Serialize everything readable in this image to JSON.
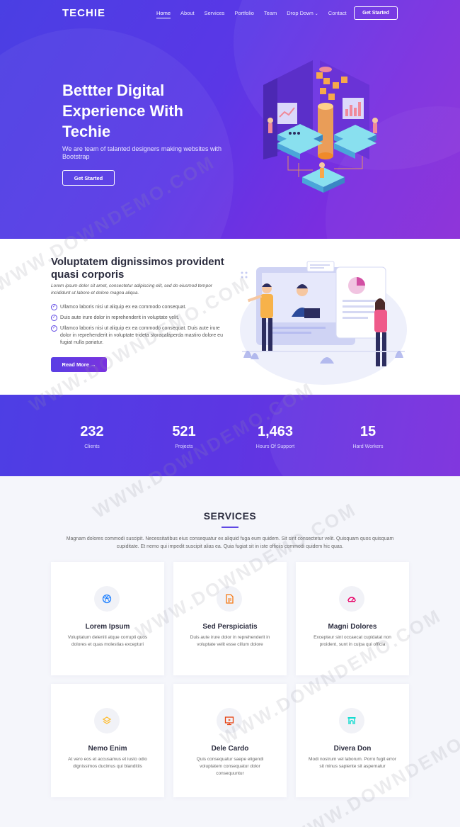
{
  "nav": {
    "logo": "TECHIE",
    "items": [
      "Home",
      "About",
      "Services",
      "Portfolio",
      "Team",
      "Drop Down",
      "Contact"
    ],
    "cta": "Get Started"
  },
  "hero": {
    "title": "Bettter Digital Experience With Techie",
    "subtitle": "We are team of talanted designers making websites with Bootstrap",
    "cta": "Get Started"
  },
  "about": {
    "title": "Voluptatem dignissimos provident quasi corporis",
    "lead": "Lorem ipsum dolor sit amet, consectetur adipiscing elit, sed do eiusmod tempor incididunt ut labore et dolore magna aliqua.",
    "bullets": [
      "Ullamco laboris nisi ut aliquip ex ea commodo consequat.",
      "Duis aute irure dolor in reprehenderit in voluptate velit.",
      "Ullamco laboris nisi ut aliquip ex ea commodo consequat. Duis aute irure dolor in reprehenderit in voluptate trideta storacalaperda mastiro dolore eu fugiat nulla pariatur."
    ],
    "cta": "Read More",
    "cta_arrow": "→"
  },
  "counts": [
    {
      "value": "232",
      "label": "Clients"
    },
    {
      "value": "521",
      "label": "Projects"
    },
    {
      "value": "1,463",
      "label": "Hours Of Support"
    },
    {
      "value": "15",
      "label": "Hard Workers"
    }
  ],
  "services": {
    "title": "SERVICES",
    "intro": "Magnam dolores commodi suscipit. Necessitatibus eius consequatur ex aliquid fuga eum quidem. Sit sint consectetur velit. Quisquam quos quisquam cupiditate. Et nemo qui impedit suscipit alias ea. Quia fugiat sit in iste officiis commodi quidem hic quas.",
    "items": [
      {
        "title": "Lorem Ipsum",
        "desc": "Voluptatum deleniti atque corrupti quos dolores et quas molestias excepturi",
        "icon": "dribbble-icon",
        "color": "#2282ff"
      },
      {
        "title": "Sed Perspiciatis",
        "desc": "Duis aute irure dolor in reprehenderit in voluptate velit esse cillum dolore",
        "icon": "file-icon",
        "color": "#f57813"
      },
      {
        "title": "Magni Dolores",
        "desc": "Excepteur sint occaecat cupidatat non proident, sunt in culpa qui officia",
        "icon": "tachometer-icon",
        "color": "#e80368"
      },
      {
        "title": "Nemo Enim",
        "desc": "At vero eos et accusamus et iusto odio dignissimos ducimus qui blanditiis",
        "icon": "layer-icon",
        "color": "#ffbb2c"
      },
      {
        "title": "Dele Cardo",
        "desc": "Quis consequatur saepe eligendi voluptatem consequatur dolor consequuntur",
        "icon": "slideshow-icon",
        "color": "#e6400e"
      },
      {
        "title": "Divera Don",
        "desc": "Modi nostrum vel laborum. Porro fugit error sit minus sapiente sit aspernatur",
        "icon": "arch-icon",
        "color": "#11dbcf"
      }
    ]
  },
  "watermark": "WWW.DOWNDEMO.COM",
  "colors": {
    "accent": "#5f48e4",
    "hero_start": "#4a3fe3",
    "hero_end": "#8b2dd8"
  }
}
